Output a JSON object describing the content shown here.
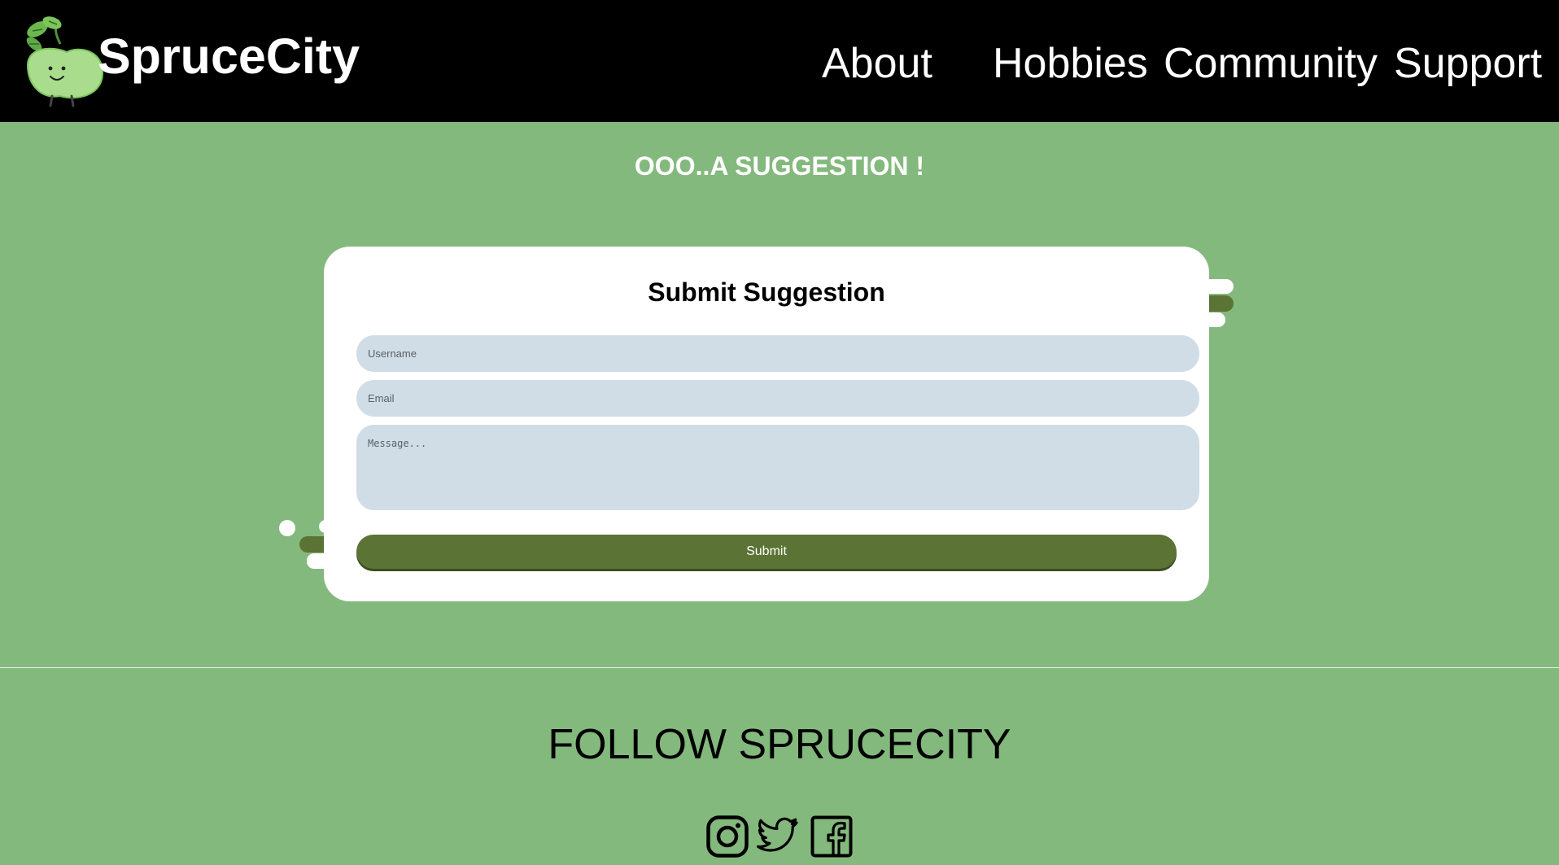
{
  "brand": {
    "name": "SpruceCity",
    "logo": "bean-sprout-mascot-logo"
  },
  "nav": {
    "items": [
      "About",
      "Hobbies",
      "Community",
      "Support"
    ]
  },
  "suggestion": {
    "heading": "OOO..A SUGGESTION !",
    "form_title": "Submit Suggestion",
    "username_placeholder": "Username",
    "email_placeholder": "Email",
    "message_placeholder": "Message...",
    "submit_label": "Submit"
  },
  "footer": {
    "follow_label": "FOLLOW SPRUCECITY",
    "social_icons": [
      "instagram-icon",
      "twitter-icon",
      "facebook-icon"
    ]
  },
  "colors": {
    "background": "#84b97d",
    "header": "#000000",
    "card": "#ffffff",
    "input": "#d0dde6",
    "accent": "#5b7335"
  }
}
